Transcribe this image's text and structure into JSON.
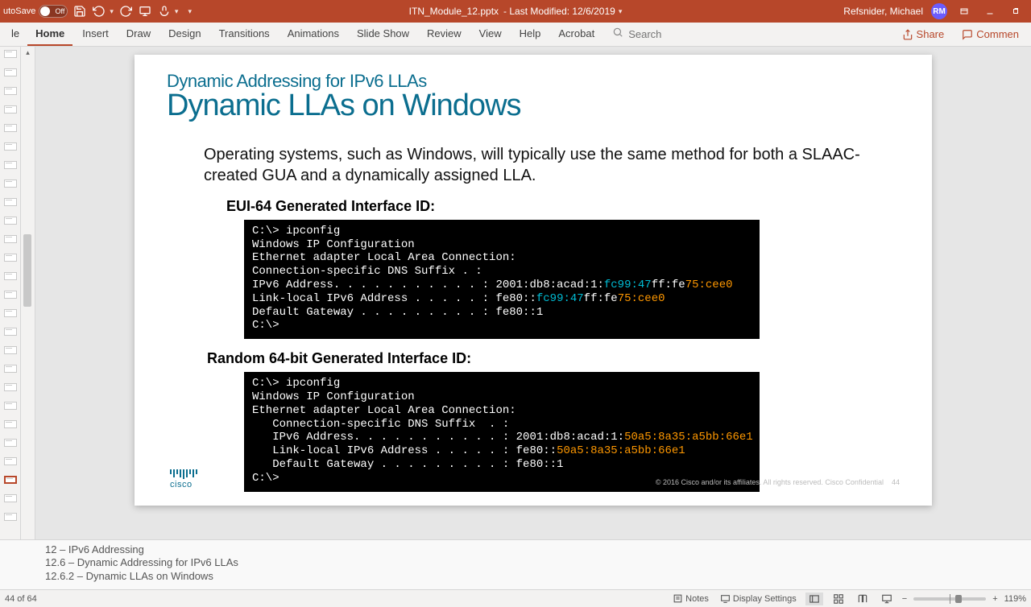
{
  "titlebar": {
    "autosave_label": "utoSave",
    "autosave_state": "Off",
    "doc_title": "ITN_Module_12.pptx",
    "last_modified": "- Last Modified: 12/6/2019",
    "user_name": "Refsnider, Michael",
    "user_initials": "RM"
  },
  "ribbon": {
    "file": "le",
    "tabs": [
      "Home",
      "Insert",
      "Draw",
      "Design",
      "Transitions",
      "Animations",
      "Slide Show",
      "Review",
      "View",
      "Help",
      "Acrobat"
    ],
    "search_placeholder": "Search",
    "share": "Share",
    "comment": "Commen"
  },
  "slide": {
    "pretitle": "Dynamic Addressing for IPv6 LLAs",
    "title": "Dynamic LLAs on Windows",
    "para": "Operating systems, such as Windows, will typically use the same method for both a SLAAC-created GUA and a dynamically assigned LLA.",
    "sub1": "EUI-64 Generated Interface ID:",
    "term1": {
      "l1": "C:\\> ipconfig",
      "l2": "Windows IP Configuration",
      "l3": "Ethernet adapter Local Area Connection:",
      "l4": "Connection-specific DNS Suffix . :",
      "l5a": "IPv6 Address. . . . . . . . . . . : 2001:db8:acad:1:",
      "l5b": "fc99:47",
      "l5c": "ff:fe",
      "l5d": "75:cee0",
      "l6a": "Link-local IPv6 Address . . . . . : fe80::",
      "l6b": "fc99:47",
      "l6c": "ff:fe",
      "l6d": "75:cee0",
      "l7": "Default Gateway . . . . . . . . . : fe80::1",
      "l8": "C:\\>"
    },
    "sub2": "Random 64-bit Generated Interface ID:",
    "term2": {
      "l1": "C:\\> ipconfig",
      "l2": "Windows IP Configuration",
      "l3": "Ethernet adapter Local Area Connection:",
      "l4": "   Connection-specific DNS Suffix  . :",
      "l5a": "   IPv6 Address. . . . . . . . . . . : 2001:db8:acad:1:",
      "l5b": "50a5:8a35:a5bb:66e1",
      "l6a": "   Link-local IPv6 Address . . . . . : fe80::",
      "l6b": "50a5:8a35:a5bb:66e1",
      "l7": "   Default Gateway . . . . . . . . . : fe80::1",
      "l8": "C:\\>"
    },
    "cisco": "cisco",
    "footer_copy": "© 2016  Cisco and/or its affiliates. All rights reserved.   Cisco Confidential",
    "footer_num": "44"
  },
  "notes": {
    "l1": "12 – IPv6 Addressing",
    "l2": "12.6 – Dynamic Addressing for IPv6 LLAs",
    "l3": "12.6.2 – Dynamic LLAs on Windows"
  },
  "statusbar": {
    "slide_count": "44 of 64",
    "notes_btn": "Notes",
    "display_btn": "Display Settings",
    "zoom": "119%"
  }
}
